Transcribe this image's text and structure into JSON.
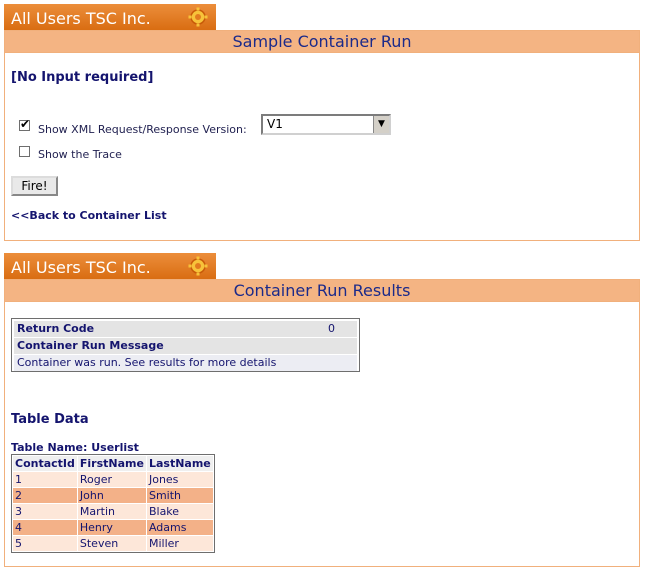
{
  "top_section": {
    "brand": "All Users TSC Inc.",
    "title": "Sample Container Run",
    "no_input": "[No Input required]",
    "show_xml_label": "Show XML Request/Response Version:",
    "show_xml_checked": true,
    "version_value": "V1",
    "show_trace_label": "Show the Trace",
    "show_trace_checked": false,
    "fire_label": "Fire!",
    "back_link": "<<Back to Container List"
  },
  "results_section": {
    "brand": "All Users TSC Inc.",
    "title": "Container Run Results",
    "return_code_label": "Return Code",
    "return_code_value": "0",
    "message_label": "Container Run Message",
    "message_value": "Container was run. See results for more details",
    "table_data_heading": "Table Data",
    "table_name": "Table Name: Userlist",
    "columns": [
      "ContactId",
      "FirstName",
      "LastName"
    ],
    "rows": [
      [
        "1",
        "Roger",
        "Jones"
      ],
      [
        "2",
        "John",
        "Smith"
      ],
      [
        "3",
        "Martin",
        "Blake"
      ],
      [
        "4",
        "Henry",
        "Adams"
      ],
      [
        "5",
        "Steven",
        "Miller"
      ]
    ]
  },
  "colors": {
    "tab_orange": "#e27a1f",
    "title_bar": "#f4b483",
    "title_text": "#1b2a8a",
    "row_light": "#fde7d9",
    "row_dark": "#f3b188"
  },
  "icons": {
    "brand_icon": "gear-icon",
    "select_arrow": "chevron-down-icon",
    "checkbox_tick": "checkmark-icon"
  }
}
